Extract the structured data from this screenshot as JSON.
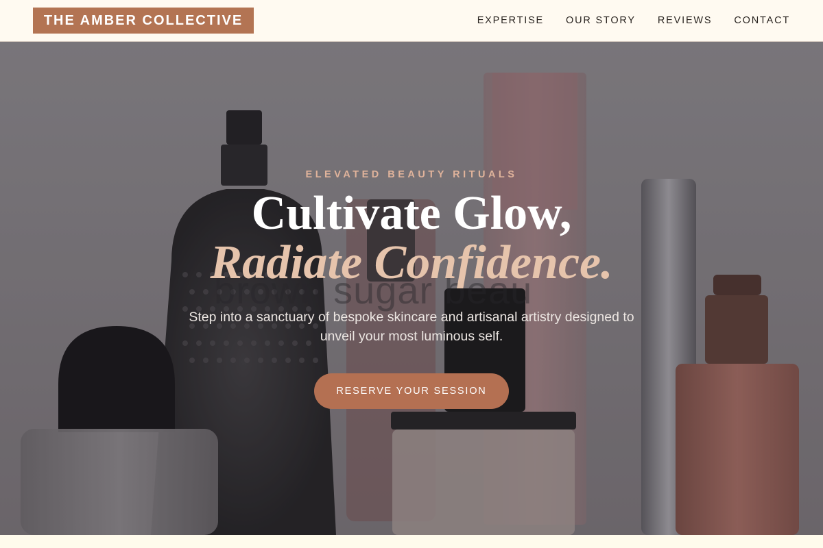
{
  "brand": {
    "name": "THE AMBER COLLECTIVE",
    "color": "#b37453"
  },
  "nav": {
    "items": [
      {
        "label": "EXPERTISE"
      },
      {
        "label": "OUR STORY"
      },
      {
        "label": "REVIEWS"
      },
      {
        "label": "CONTACT"
      }
    ]
  },
  "hero": {
    "eyebrow": "ELEVATED BEAUTY RITUALS",
    "title_line1": "Cultivate Glow,",
    "title_line2": "Radiate Confidence.",
    "subtitle": "Step into a sanctuary of bespoke skincare and artisanal artistry designed to unveil your most luminous self.",
    "cta_label": "RESERVE YOUR SESSION",
    "background_watermark": "brown sugar beau",
    "accent_color": "#e6c4ac",
    "button_color": "#b47052"
  }
}
